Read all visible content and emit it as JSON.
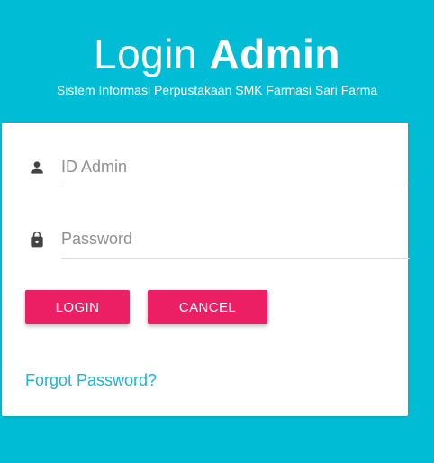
{
  "header": {
    "title_light": "Login",
    "title_bold": "Admin",
    "subtitle": "Sistem Informasi Perpustakaan SMK Farmasi Sari Farma"
  },
  "form": {
    "id_admin": {
      "value": "",
      "placeholder": "ID Admin",
      "icon": "person-icon"
    },
    "password": {
      "value": "",
      "placeholder": "Password",
      "icon": "lock-icon"
    },
    "login_label": "LOGIN",
    "cancel_label": "CANCEL",
    "forgot_label": "Forgot Password?"
  },
  "colors": {
    "background": "#00bcd4",
    "button": "#ec1e64",
    "link": "#1fb3d1"
  }
}
